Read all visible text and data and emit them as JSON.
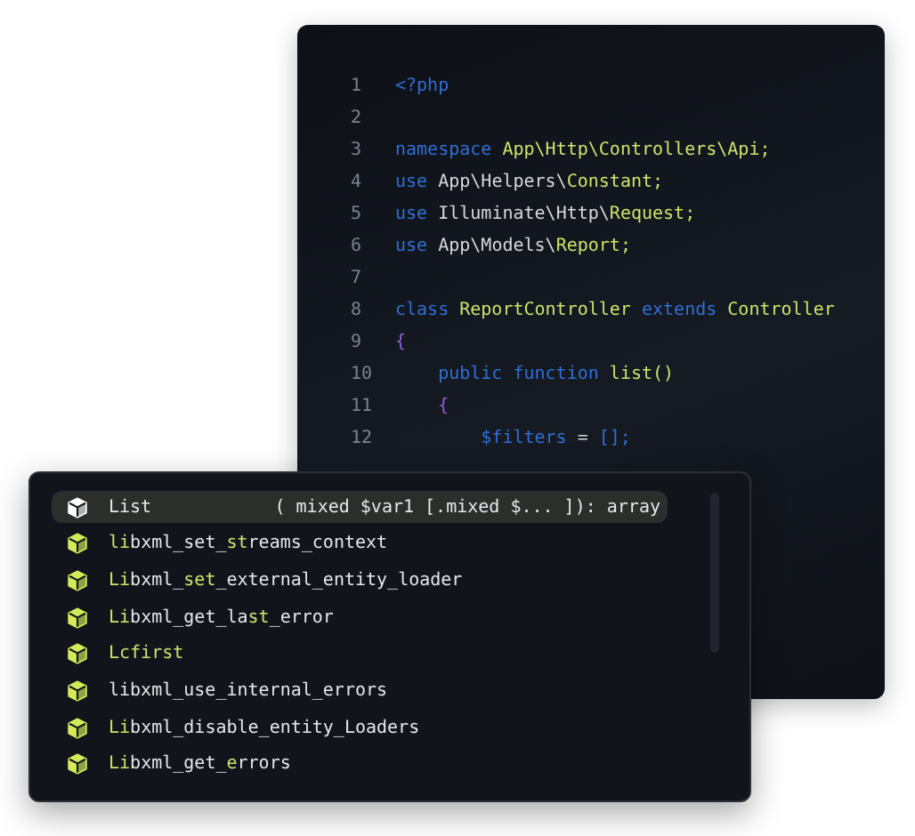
{
  "editor": {
    "lines": [
      {
        "number": "1",
        "tokens": [
          {
            "text": "<?php",
            "kind": "keyword"
          }
        ]
      },
      {
        "number": "2"
      },
      {
        "number": "3",
        "tokens": [
          {
            "text": "namespace ",
            "kind": "keyword"
          },
          {
            "text": "App\\Http\\Controllers\\Api;",
            "kind": "name"
          }
        ]
      },
      {
        "number": "4",
        "tokens": [
          {
            "text": "use ",
            "kind": "keyword"
          },
          {
            "text": "App\\Helpers\\",
            "kind": "plain"
          },
          {
            "text": "Constant;",
            "kind": "name"
          }
        ]
      },
      {
        "number": "5",
        "tokens": [
          {
            "text": "use ",
            "kind": "keyword"
          },
          {
            "text": "Illuminate\\Http\\",
            "kind": "plain"
          },
          {
            "text": "Request;",
            "kind": "name"
          }
        ]
      },
      {
        "number": "6",
        "tokens": [
          {
            "text": "use ",
            "kind": "keyword"
          },
          {
            "text": "App\\Models\\",
            "kind": "plain"
          },
          {
            "text": "Report;",
            "kind": "name"
          }
        ]
      },
      {
        "number": "7"
      },
      {
        "number": "8",
        "tokens": [
          {
            "text": "class ",
            "kind": "keyword"
          },
          {
            "text": "ReportController ",
            "kind": "name"
          },
          {
            "text": "extends ",
            "kind": "keyword"
          },
          {
            "text": "Controller",
            "kind": "name"
          }
        ]
      },
      {
        "number": "9",
        "tokens": [
          {
            "text": "{",
            "kind": "brace"
          }
        ]
      },
      {
        "number": "10",
        "tokens": [
          {
            "text": "    public function ",
            "kind": "keyword"
          },
          {
            "text": "list()",
            "kind": "name"
          }
        ]
      },
      {
        "number": "11",
        "tokens": [
          {
            "text": "    {",
            "kind": "brace"
          }
        ]
      },
      {
        "number": "12",
        "tokens": [
          {
            "text": "        $filters",
            "kind": "keyword"
          },
          {
            "text": " = ",
            "kind": "plain"
          },
          {
            "text": "[];",
            "kind": "keyword"
          }
        ]
      }
    ]
  },
  "suggestions": [
    {
      "selected": true,
      "parts": [
        {
          "text": "List",
          "match": false
        }
      ],
      "signature": "( mixed $var1 [.mixed $... ]): array"
    },
    {
      "selected": false,
      "parts": [
        {
          "text": "li",
          "match": true
        },
        {
          "text": "bxml_set_",
          "match": false
        },
        {
          "text": "st",
          "match": true
        },
        {
          "text": "reams_context",
          "match": false
        }
      ]
    },
    {
      "selected": false,
      "parts": [
        {
          "text": "Li",
          "match": true
        },
        {
          "text": "bxml_",
          "match": false
        },
        {
          "text": "set",
          "match": true
        },
        {
          "text": "_external_entity_loader",
          "match": false
        }
      ]
    },
    {
      "selected": false,
      "parts": [
        {
          "text": "Li",
          "match": true
        },
        {
          "text": "bxml_get_la",
          "match": false
        },
        {
          "text": "st",
          "match": true
        },
        {
          "text": "_error",
          "match": false
        }
      ]
    },
    {
      "selected": false,
      "parts": [
        {
          "text": "Lcfirst",
          "match": true
        }
      ]
    },
    {
      "selected": false,
      "parts": [
        {
          "text": "libxml_use_internal_errors",
          "match": false
        }
      ]
    },
    {
      "selected": false,
      "parts": [
        {
          "text": "Li",
          "match": true
        },
        {
          "text": "bxml_disable_entity_Loaders",
          "match": false
        }
      ]
    },
    {
      "selected": false,
      "parts": [
        {
          "text": "Li",
          "match": true
        },
        {
          "text": "bxml_get_",
          "match": false
        },
        {
          "text": "e",
          "match": true
        },
        {
          "text": "rrors",
          "match": false
        }
      ]
    }
  ]
}
